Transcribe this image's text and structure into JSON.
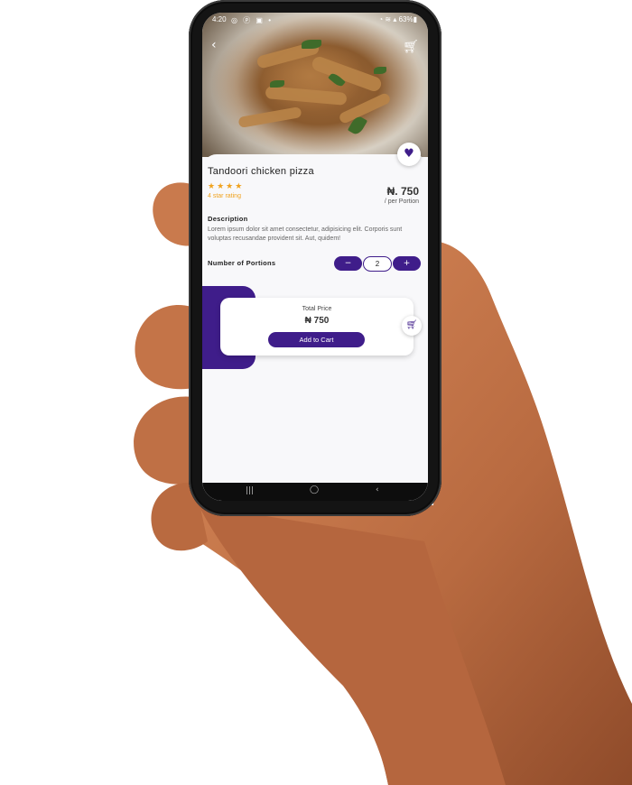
{
  "status_bar": {
    "time": "4:20",
    "left_icons": "◎ ⓟ ▣ •",
    "right": "◔ ≋ ▴ 63%▮"
  },
  "header": {
    "back_icon": "back-arrow-icon",
    "cart_icon": "cart-icon"
  },
  "product": {
    "name": "Tandoori chicken pizza",
    "stars": "★★★★",
    "rating_text": "4 star rating",
    "price": "₦. 750",
    "price_unit": "/ per Portion",
    "description_label": "Description",
    "description": "Lorem ipsum dolor sit amet consectetur, adipisicing elit. Corporis sunt voluptas recusandae provident sit. Aut, quidem!"
  },
  "portions": {
    "label": "Number of Portions",
    "minus": "−",
    "plus": "+",
    "quantity": "2"
  },
  "total": {
    "label": "Total Price",
    "value": "₦ 750",
    "button": "Add to Cart"
  },
  "nav": {
    "recent": "|||",
    "home": "◯",
    "back": "‹"
  },
  "colors": {
    "accent": "#3f1d8a",
    "star": "#f0a21d"
  }
}
